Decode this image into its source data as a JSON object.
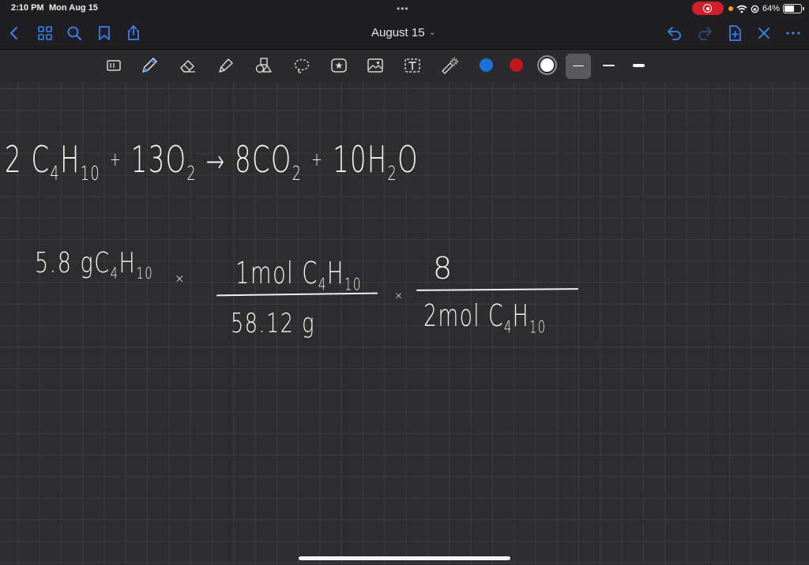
{
  "status_bar": {
    "time": "2:10 PM",
    "date": "Mon Aug 15",
    "dots": "•••",
    "battery_percent": "64%",
    "battery_level": 0.64
  },
  "nav": {
    "title": "August 15",
    "accent_color": "#3b82f6",
    "left_icons": [
      "back-icon",
      "thumbnails-icon",
      "search-icon",
      "bookmark-icon",
      "share-icon"
    ],
    "right_icons": [
      "undo-icon",
      "redo-icon",
      "add-page-icon",
      "close-icon",
      "more-icon"
    ]
  },
  "toolbar": {
    "tools": [
      "read-mode-icon",
      "pen-icon",
      "eraser-icon",
      "highlighter-icon",
      "shapes-icon",
      "lasso-icon",
      "sticker-icon",
      "image-icon",
      "text-icon",
      "laser-pointer-icon"
    ],
    "selected_tool": "pen-icon",
    "colors": [
      "#1d6fe0",
      "#c4151c",
      "#ffffff"
    ],
    "selected_color": "#ffffff",
    "stroke_widths": [
      "thin",
      "medium",
      "thick"
    ],
    "selected_stroke": "thin"
  },
  "note": {
    "equation": {
      "coef1": "2",
      "reactant1": "C",
      "reactant1_sub1": "4",
      "reactant1_h": "H",
      "reactant1_sub2": "10",
      "plus1": "+",
      "coef2": "13",
      "reactant2": "O",
      "reactant2_sub": "2",
      "arrow": "→",
      "coef3": "8",
      "product1": "CO",
      "product1_sub": "2",
      "plus2": "+",
      "coef4": "10",
      "product2": "H",
      "product2_sub": "2",
      "product2_o": "O"
    },
    "calculation": {
      "given_mass": "5.8 g",
      "given_formula": "C",
      "given_sub1": "4",
      "given_h": "H",
      "given_sub2": "10",
      "times1": "×",
      "frac1_numerator": "1mol C",
      "frac1_num_sub1": "4",
      "frac1_num_h": "H",
      "frac1_num_sub2": "10",
      "frac1_denominator": "58.12 g",
      "times2": "×",
      "frac2_numerator": "8",
      "frac2_denominator": "2mol C",
      "frac2_den_sub1": "4",
      "frac2_den_h": "H",
      "frac2_den_sub2": "10"
    }
  }
}
